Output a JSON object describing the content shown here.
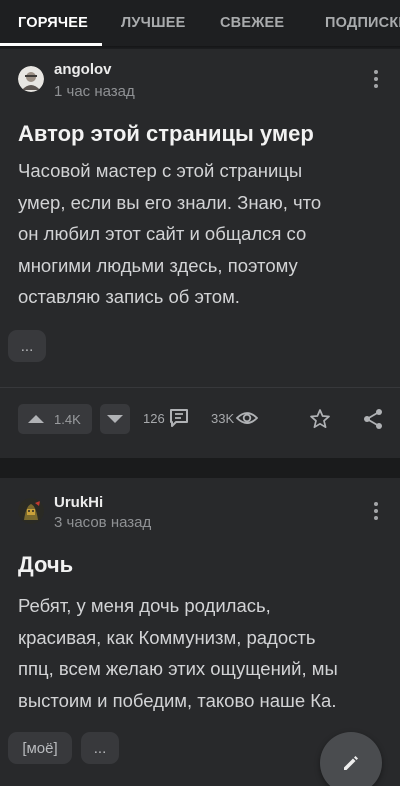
{
  "tabs": [
    {
      "label": "Горячее",
      "active": true
    },
    {
      "label": "Лучшее",
      "active": false
    },
    {
      "label": "Свежее",
      "active": false
    },
    {
      "label": "Подписки",
      "active": false
    }
  ],
  "posts": [
    {
      "author": "angolov",
      "time": "1 час назад",
      "title": "Автор этой страницы умер",
      "body_lines": [
        "Часовой мастер с этой страницы",
        "умер, если вы его знали. Знаю, что",
        "он любил этот сайт и общался со",
        "многими людьми здесь, поэтому",
        "оставляю запись об этом."
      ],
      "tags": [
        "..."
      ],
      "rating": "1.4K",
      "comments": "126",
      "views": "33K"
    },
    {
      "author": "UrukHi",
      "time": "3 часов назад",
      "title": "Дочь",
      "body_lines": [
        "Ребят, у меня дочь родилась,",
        "красивая, как Коммунизм, радость",
        "ппц, всем желаю этих ощущений, мы",
        "выстоим и победим, таково наше Ка."
      ],
      "tags": [
        "[моё]",
        "..."
      ]
    }
  ],
  "icons": {
    "upvote": "triangle-up-icon",
    "downvote": "triangle-down-icon",
    "comments": "comment-icon",
    "views": "eye-icon",
    "save": "star-icon",
    "share": "share-icon",
    "menu": "more-vertical-icon",
    "compose": "pencil-icon"
  },
  "colors": {
    "background": "#1e1f21",
    "card": "#28292b",
    "chip": "#38393c",
    "text": "#d2d3d5",
    "muted": "#8f9194"
  }
}
